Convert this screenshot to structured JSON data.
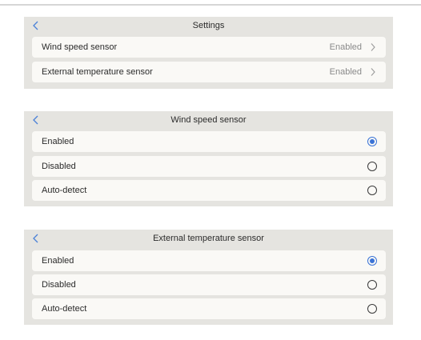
{
  "settings": {
    "title": "Settings",
    "items": [
      {
        "label": "Wind speed sensor",
        "value": "Enabled"
      },
      {
        "label": "External temperature sensor",
        "value": "Enabled"
      }
    ]
  },
  "wind_speed": {
    "title": "Wind speed sensor",
    "options": [
      {
        "label": "Enabled",
        "selected": true
      },
      {
        "label": "Disabled",
        "selected": false
      },
      {
        "label": "Auto-detect",
        "selected": false
      }
    ]
  },
  "external_temperature": {
    "title": "External temperature sensor",
    "options": [
      {
        "label": "Enabled",
        "selected": true
      },
      {
        "label": "Disabled",
        "selected": false
      },
      {
        "label": "Auto-detect",
        "selected": false
      }
    ]
  },
  "icons": {
    "back": "chevron-left-icon",
    "forward": "chevron-right-icon",
    "radio": "radio-button-icon"
  },
  "colors": {
    "accent": "#3a73d6",
    "panel": "#e5e4e0",
    "row": "#faf9f6"
  }
}
